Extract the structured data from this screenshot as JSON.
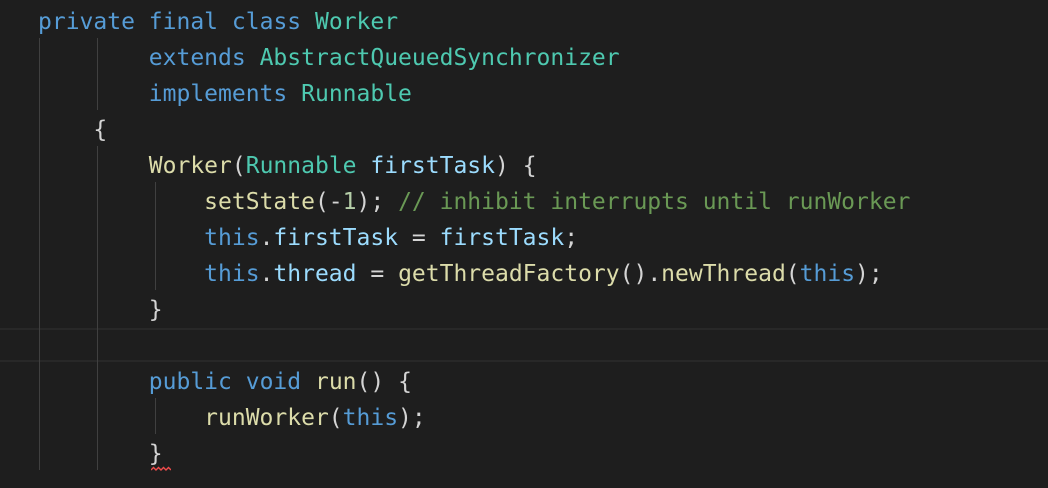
{
  "editor": {
    "lines": [
      [
        {
          "t": "private",
          "c": "kw"
        },
        {
          "t": " ",
          "c": "pn"
        },
        {
          "t": "final",
          "c": "kw"
        },
        {
          "t": " ",
          "c": "pn"
        },
        {
          "t": "class",
          "c": "kw"
        },
        {
          "t": " ",
          "c": "pn"
        },
        {
          "t": "Worker",
          "c": "ty"
        }
      ],
      [
        {
          "t": "        ",
          "c": "pn"
        },
        {
          "t": "extends",
          "c": "kw"
        },
        {
          "t": " ",
          "c": "pn"
        },
        {
          "t": "AbstractQueuedSynchronizer",
          "c": "ty"
        }
      ],
      [
        {
          "t": "        ",
          "c": "pn"
        },
        {
          "t": "implements",
          "c": "kw"
        },
        {
          "t": " ",
          "c": "pn"
        },
        {
          "t": "Runnable",
          "c": "ty"
        }
      ],
      [
        {
          "t": "    {",
          "c": "pn"
        }
      ],
      [
        {
          "t": "        ",
          "c": "pn"
        },
        {
          "t": "Worker",
          "c": "fn"
        },
        {
          "t": "(",
          "c": "pn"
        },
        {
          "t": "Runnable",
          "c": "ty"
        },
        {
          "t": " ",
          "c": "pn"
        },
        {
          "t": "firstTask",
          "c": "vr"
        },
        {
          "t": ") {",
          "c": "pn"
        }
      ],
      [
        {
          "t": "            ",
          "c": "pn"
        },
        {
          "t": "setState",
          "c": "fn"
        },
        {
          "t": "(-",
          "c": "pn"
        },
        {
          "t": "1",
          "c": "nm"
        },
        {
          "t": "); ",
          "c": "pn"
        },
        {
          "t": "// inhibit interrupts until runWorker",
          "c": "cm"
        }
      ],
      [
        {
          "t": "            ",
          "c": "pn"
        },
        {
          "t": "this",
          "c": "kw"
        },
        {
          "t": ".",
          "c": "pn"
        },
        {
          "t": "firstTask",
          "c": "vr"
        },
        {
          "t": " = ",
          "c": "pn"
        },
        {
          "t": "firstTask",
          "c": "vr"
        },
        {
          "t": ";",
          "c": "pn"
        }
      ],
      [
        {
          "t": "            ",
          "c": "pn"
        },
        {
          "t": "this",
          "c": "kw"
        },
        {
          "t": ".",
          "c": "pn"
        },
        {
          "t": "thread",
          "c": "vr"
        },
        {
          "t": " = ",
          "c": "pn"
        },
        {
          "t": "getThreadFactory",
          "c": "fn"
        },
        {
          "t": "().",
          "c": "pn"
        },
        {
          "t": "newThread",
          "c": "fn"
        },
        {
          "t": "(",
          "c": "pn"
        },
        {
          "t": "this",
          "c": "kw"
        },
        {
          "t": ");",
          "c": "pn"
        }
      ],
      [
        {
          "t": "        }",
          "c": "pn"
        }
      ],
      [],
      [
        {
          "t": "        ",
          "c": "pn"
        },
        {
          "t": "public",
          "c": "kw"
        },
        {
          "t": " ",
          "c": "pn"
        },
        {
          "t": "void",
          "c": "kw"
        },
        {
          "t": " ",
          "c": "pn"
        },
        {
          "t": "run",
          "c": "fn"
        },
        {
          "t": "() {",
          "c": "pn"
        }
      ],
      [
        {
          "t": "            ",
          "c": "pn"
        },
        {
          "t": "runWorker",
          "c": "fn"
        },
        {
          "t": "(",
          "c": "pn"
        },
        {
          "t": "this",
          "c": "kw"
        },
        {
          "t": ");",
          "c": "pn"
        }
      ],
      [
        {
          "t": "        }",
          "c": "pn"
        }
      ]
    ]
  },
  "colors": {
    "background": "#1e1e1e",
    "keyword": "#569cd6",
    "type": "#4ec9b0",
    "function": "#dcdcaa",
    "variable": "#9cdcfe",
    "punctuation": "#d4d4d4",
    "number": "#b5cea8",
    "comment": "#6a9955",
    "error_squiggle": "#f14c4c"
  }
}
